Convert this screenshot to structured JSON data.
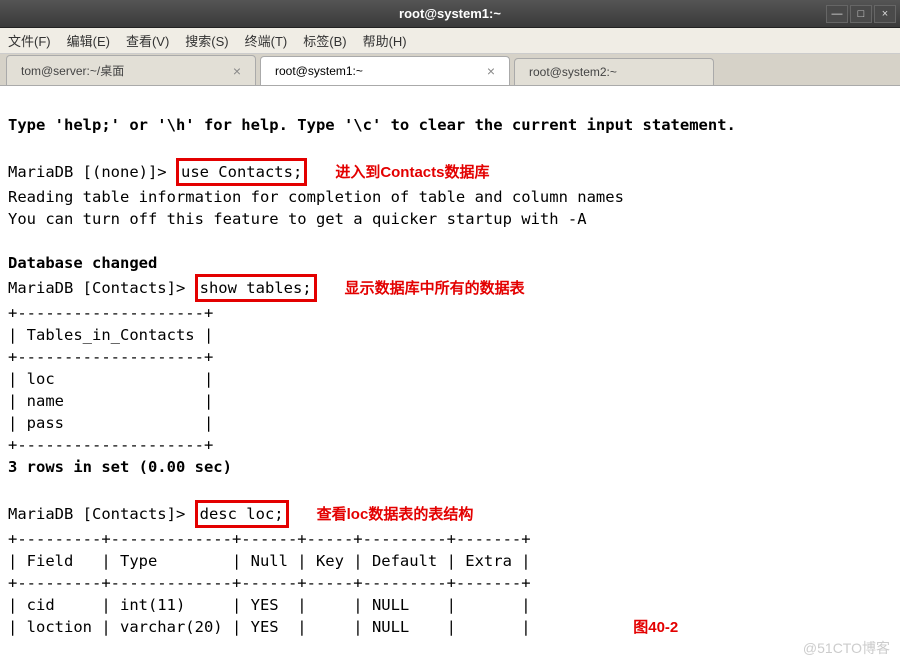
{
  "window": {
    "title": "root@system1:~",
    "btn_min": "—",
    "btn_max": "□",
    "btn_close": "×"
  },
  "menu": {
    "file": "文件(F)",
    "edit": "编辑(E)",
    "view": "查看(V)",
    "search": "搜索(S)",
    "terminal": "终端(T)",
    "tabs": "标签(B)",
    "help": "帮助(H)"
  },
  "tabs": [
    {
      "label": "tom@server:~/桌面",
      "close": "×",
      "active": false
    },
    {
      "label": "root@system1:~",
      "close": "×",
      "active": true
    },
    {
      "label": "root@system2:~",
      "close": "",
      "active": false
    }
  ],
  "term": {
    "l1": "Type 'help;' or '\\h' for help. Type '\\c' to clear the current input statement.",
    "l2a": "MariaDB [(none)]> ",
    "l2b": "use Contacts;",
    "a1": "进入到Contacts数据库",
    "l3": "Reading table information for completion of table and column names",
    "l4": "You can turn off this feature to get a quicker startup with -A",
    "l5": "Database changed",
    "l6a": "MariaDB [Contacts]> ",
    "l6b": "show tables;",
    "a2": "显示数据库中所有的数据表",
    "sep1": "+--------------------+",
    "thead": "| Tables_in_Contacts |",
    "r1": "| loc                |",
    "r2": "| name               |",
    "r3": "| pass               |",
    "l7": "3 rows in set (0.00 sec)",
    "l8a": "MariaDB [Contacts]> ",
    "l8b": "desc loc;",
    "a3": "查看loc数据表的表结构",
    "sep2": "+---------+-------------+------+-----+---------+-------+",
    "dhead": "| Field   | Type        | Null | Key | Default | Extra |",
    "d1": "| cid     | int(11)     | YES  |     | NULL    |       |",
    "d2": "| loction | varchar(20) | YES  |     | NULL    |       |",
    "figlabel": "图40-2"
  },
  "watermark": "@51CTO博客"
}
